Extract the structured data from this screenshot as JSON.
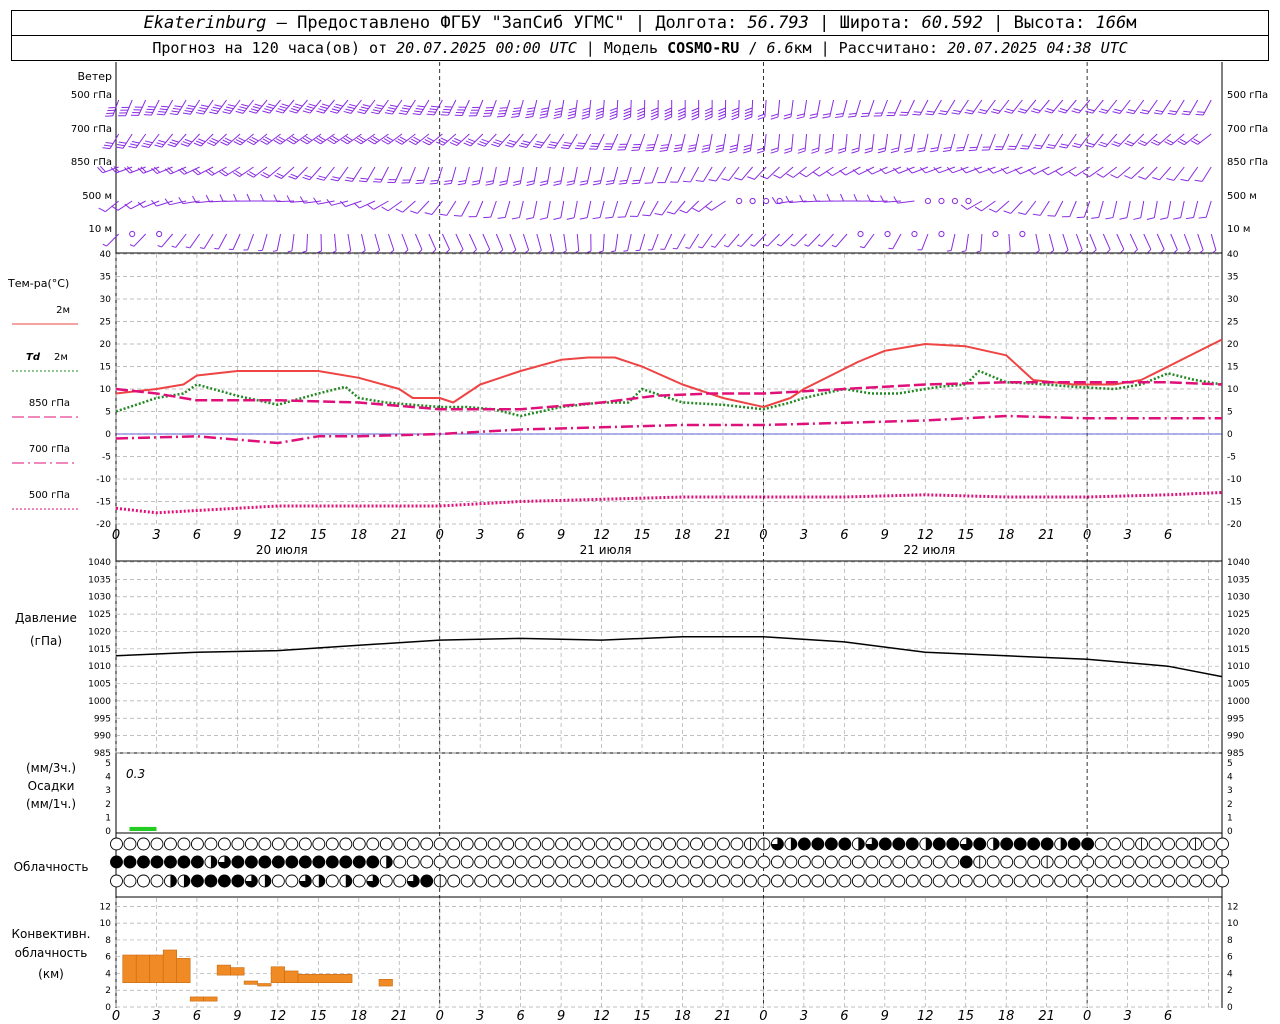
{
  "header": {
    "line1": {
      "station": "Ekaterinburg",
      "provider": " — Предоставлено ФГБУ \"ЗапСиб УГМС\" | Долгота: ",
      "lon": "56.793",
      "lat_label": " | Широта: ",
      "lat": "60.592",
      "alt_label": " | Высота: ",
      "alt": "166",
      "alt_unit": "м"
    },
    "line2": {
      "forecast_label": "Прогноз на 120 часа(ов) от ",
      "start_time": "20.07.2025 00:00 UTC",
      "model_label": " | Модель ",
      "model_name": "COSMO-RU",
      "model_sep": " / ",
      "resolution": "6.6",
      "res_unit": "км",
      "calc_label": " | Рассчитано: ",
      "calc_time": "20.07.2025 04:38 UTC"
    }
  },
  "wind_panel": {
    "title": "Ветер",
    "levels": [
      "500 гПа",
      "700 гПа",
      "850 гПа",
      "500 м",
      "10 м"
    ]
  },
  "temp_panel": {
    "title": "Тем-ра(°С)",
    "legend": [
      {
        "label": "2м",
        "color": "#ee4444",
        "style": "solid"
      },
      {
        "label": "Td 2м",
        "color": "#228822",
        "style": "dotted"
      },
      {
        "label": "850 гПа",
        "color": "#e0107a",
        "style": "dashed"
      },
      {
        "label": "700 гПа",
        "color": "#e0107a",
        "style": "dashdot"
      },
      {
        "label": "500 гПа",
        "color": "#e0107a",
        "style": "dotted"
      }
    ]
  },
  "x_axis": {
    "tick_labels": [
      "0",
      "3",
      "6",
      "9",
      "12",
      "15",
      "18",
      "21",
      "0",
      "3",
      "6",
      "9",
      "12",
      "15",
      "18",
      "21",
      "0",
      "3",
      "6",
      "9",
      "12",
      "15",
      "18",
      "21",
      "0",
      "3",
      "6"
    ],
    "date_labels": [
      {
        "text": "20 июля",
        "at": 12
      },
      {
        "text": "21 июля",
        "at": 36
      },
      {
        "text": "22 июля",
        "at": 60
      }
    ]
  },
  "pressure_panel": {
    "title": "Давление",
    "unit": "(гПа)"
  },
  "precip_panel": {
    "unit_top": "(мм/3ч.)",
    "title": "Осадки",
    "unit_bottom": "(мм/1ч.)",
    "annotation": "0.3"
  },
  "cloud_panel": {
    "title": "Облачность"
  },
  "conv_panel": {
    "title_1": "Конвективн.",
    "title_2": "облачность",
    "unit": "(км)"
  },
  "chart_data": [
    {
      "type": "line",
      "title": "Тем-ра(°С)",
      "x_unit": "hours from 20.07.2025 00:00 UTC",
      "ylim": [
        -20,
        40
      ],
      "yticks": [
        -20,
        -15,
        -10,
        -5,
        0,
        5,
        10,
        15,
        20,
        25,
        30,
        35,
        40
      ],
      "grid": true,
      "series": [
        {
          "name": "2м",
          "color": "#ee4444",
          "points": [
            [
              0,
              9
            ],
            [
              3,
              10
            ],
            [
              5,
              11
            ],
            [
              6,
              13
            ],
            [
              9,
              14
            ],
            [
              12,
              14
            ],
            [
              15,
              14
            ],
            [
              18,
              12.5
            ],
            [
              21,
              10
            ],
            [
              22,
              8
            ],
            [
              24,
              8
            ],
            [
              25,
              7
            ],
            [
              27,
              11
            ],
            [
              30,
              14
            ],
            [
              33,
              16.5
            ],
            [
              35,
              17
            ],
            [
              37,
              17
            ],
            [
              39,
              15
            ],
            [
              42,
              11
            ],
            [
              45,
              8
            ],
            [
              48,
              6
            ],
            [
              50,
              8
            ],
            [
              51,
              10
            ],
            [
              53,
              13
            ],
            [
              55,
              16
            ],
            [
              57,
              18.5
            ],
            [
              60,
              20
            ],
            [
              63,
              19.5
            ],
            [
              66,
              17.5
            ],
            [
              68,
              12
            ],
            [
              71,
              11
            ],
            [
              74,
              11
            ],
            [
              76,
              12
            ],
            [
              77,
              13.5
            ],
            [
              80,
              18
            ],
            [
              82,
              21
            ]
          ]
        },
        {
          "name": "Td 2м",
          "color": "#228822",
          "points": [
            [
              0,
              5
            ],
            [
              3,
              8
            ],
            [
              5,
              9
            ],
            [
              6,
              11
            ],
            [
              9,
              8.5
            ],
            [
              12,
              6.5
            ],
            [
              15,
              9
            ],
            [
              17,
              10.5
            ],
            [
              18,
              8
            ],
            [
              20,
              7
            ],
            [
              22,
              6.5
            ],
            [
              24,
              6
            ],
            [
              26,
              6
            ],
            [
              28,
              5.5
            ],
            [
              30,
              4
            ],
            [
              33,
              6
            ],
            [
              36,
              7
            ],
            [
              38,
              7
            ],
            [
              39,
              10
            ],
            [
              42,
              7
            ],
            [
              45,
              6.5
            ],
            [
              48,
              5.5
            ],
            [
              50,
              7
            ],
            [
              51,
              8
            ],
            [
              54,
              10
            ],
            [
              56,
              9
            ],
            [
              58,
              9
            ],
            [
              61,
              10.5
            ],
            [
              63,
              11
            ],
            [
              64,
              14
            ],
            [
              66,
              11.5
            ],
            [
              69,
              11
            ],
            [
              71,
              10.5
            ],
            [
              74,
              10
            ],
            [
              76,
              11
            ],
            [
              78,
              13.5
            ],
            [
              80,
              12
            ],
            [
              82,
              11
            ]
          ]
        },
        {
          "name": "850 гПа",
          "color": "#e0107a",
          "points": [
            [
              0,
              10
            ],
            [
              3,
              9
            ],
            [
              6,
              7.5
            ],
            [
              12,
              7.5
            ],
            [
              18,
              7
            ],
            [
              22,
              6
            ],
            [
              24,
              5.5
            ],
            [
              30,
              5.5
            ],
            [
              36,
              7
            ],
            [
              40,
              8.5
            ],
            [
              44,
              9
            ],
            [
              48,
              9
            ],
            [
              54,
              10
            ],
            [
              60,
              11
            ],
            [
              66,
              11.5
            ],
            [
              72,
              11.5
            ],
            [
              78,
              11.5
            ],
            [
              82,
              11
            ]
          ]
        },
        {
          "name": "700 гПа",
          "color": "#e0107a",
          "points": [
            [
              0,
              -1
            ],
            [
              6,
              -0.5
            ],
            [
              12,
              -2
            ],
            [
              15,
              -0.5
            ],
            [
              18,
              -0.5
            ],
            [
              24,
              0
            ],
            [
              30,
              1
            ],
            [
              36,
              1.5
            ],
            [
              42,
              2
            ],
            [
              48,
              2
            ],
            [
              54,
              2.5
            ],
            [
              60,
              3
            ],
            [
              66,
              4
            ],
            [
              72,
              3.5
            ],
            [
              78,
              3.5
            ],
            [
              82,
              3.5
            ]
          ]
        },
        {
          "name": "500 гПа",
          "color": "#e0107a",
          "points": [
            [
              0,
              -16.5
            ],
            [
              3,
              -17.5
            ],
            [
              6,
              -17
            ],
            [
              12,
              -16
            ],
            [
              18,
              -16
            ],
            [
              24,
              -16
            ],
            [
              30,
              -15
            ],
            [
              36,
              -14.5
            ],
            [
              42,
              -14
            ],
            [
              48,
              -14
            ],
            [
              54,
              -14
            ],
            [
              60,
              -13.5
            ],
            [
              66,
              -14
            ],
            [
              72,
              -14
            ],
            [
              78,
              -13.5
            ],
            [
              82,
              -13
            ]
          ]
        }
      ]
    },
    {
      "type": "line",
      "title": "Давление",
      "ylabel": "(гПа)",
      "ylim": [
        985,
        1040
      ],
      "yticks": [
        985,
        990,
        995,
        1000,
        1005,
        1010,
        1015,
        1020,
        1025,
        1030,
        1035,
        1040
      ],
      "grid": true,
      "series": [
        {
          "color": "#000000",
          "points": [
            [
              0,
              1013
            ],
            [
              3,
              1013.5
            ],
            [
              6,
              1014
            ],
            [
              12,
              1014.5
            ],
            [
              18,
              1016
            ],
            [
              24,
              1017.5
            ],
            [
              30,
              1018
            ],
            [
              36,
              1017.5
            ],
            [
              42,
              1018.5
            ],
            [
              48,
              1018.5
            ],
            [
              54,
              1017
            ],
            [
              60,
              1014
            ],
            [
              66,
              1013
            ],
            [
              72,
              1012
            ],
            [
              78,
              1010
            ],
            [
              82,
              1007
            ]
          ]
        }
      ]
    },
    {
      "type": "bar",
      "title": "Осадки",
      "ylim": [
        0,
        5
      ],
      "yticks": [
        0,
        1,
        2,
        3,
        4,
        5
      ],
      "series": [
        {
          "color": "#22cc22",
          "bars": [
            [
              1,
              3,
              0.3
            ]
          ]
        }
      ]
    },
    {
      "type": "bar",
      "title": "Конвективн. облачность",
      "ylabel": "(км)",
      "ylim": [
        0,
        13
      ],
      "yticks": [
        0,
        2,
        4,
        6,
        8,
        10,
        12
      ],
      "series": [
        {
          "color": "#f08a24",
          "bars": [
            [
              0.5,
              1.5,
              2.9,
              6.2
            ],
            [
              1.5,
              2.5,
              2.9,
              6.2
            ],
            [
              2.5,
              3.5,
              2.9,
              6.2
            ],
            [
              3.5,
              4.5,
              2.9,
              6.8
            ],
            [
              4.5,
              5.5,
              2.9,
              5.8
            ],
            [
              5.5,
              6.5,
              0.7,
              1.2
            ],
            [
              6.5,
              7.5,
              0.7,
              1.2
            ],
            [
              7.5,
              8.5,
              3.8,
              5.0
            ],
            [
              8.5,
              9.5,
              3.8,
              4.7
            ],
            [
              9.5,
              10.5,
              2.7,
              3.1
            ],
            [
              10.5,
              11.5,
              2.5,
              2.8
            ],
            [
              11.5,
              12.5,
              2.9,
              4.8
            ],
            [
              12.5,
              13.5,
              2.9,
              4.3
            ],
            [
              13.5,
              17.5,
              2.9,
              3.9
            ],
            [
              19.5,
              20.5,
              2.5,
              3.3
            ]
          ]
        }
      ]
    }
  ]
}
